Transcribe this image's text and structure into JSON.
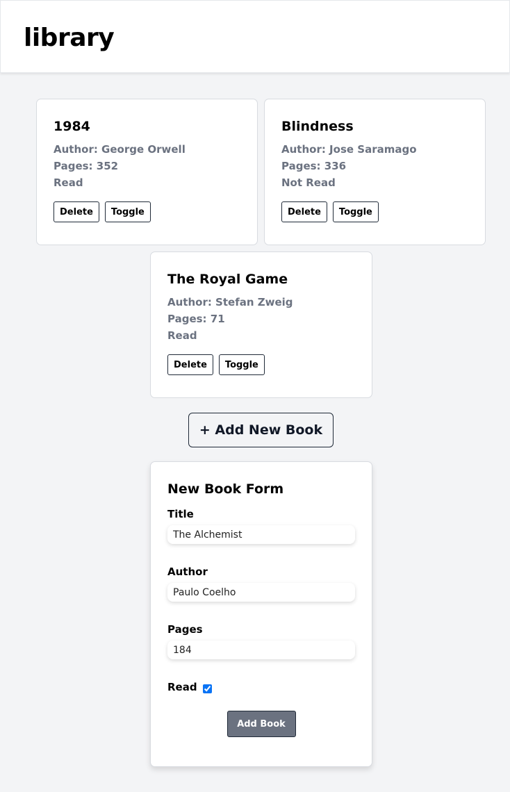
{
  "header": {
    "title": "library"
  },
  "books": [
    {
      "title": "1984",
      "author": "Author: George Orwell",
      "pages": "Pages: 352",
      "status": "Read",
      "delete_label": "Delete",
      "toggle_label": "Toggle"
    },
    {
      "title": "Blindness",
      "author": "Author: Jose Saramago",
      "pages": "Pages: 336",
      "status": "Not Read",
      "delete_label": "Delete",
      "toggle_label": "Toggle"
    },
    {
      "title": "The Royal Game",
      "author": "Author: Stefan Zweig",
      "pages": "Pages: 71",
      "status": "Read",
      "delete_label": "Delete",
      "toggle_label": "Toggle"
    }
  ],
  "add_new_button": {
    "label": "+ Add New Book"
  },
  "form": {
    "heading": "New Book Form",
    "title_label": "Title",
    "title_value": "The Alchemist",
    "author_label": "Author",
    "author_value": "Paulo Coelho",
    "pages_label": "Pages",
    "pages_value": "184",
    "read_label": "Read",
    "read_checked": true,
    "submit_label": "Add Book"
  },
  "colors": {
    "background": "#f3f4f6",
    "muted_text": "#6b7280",
    "submit_bg": "#6b7280",
    "checkbox_accent": "#0b74f5"
  }
}
